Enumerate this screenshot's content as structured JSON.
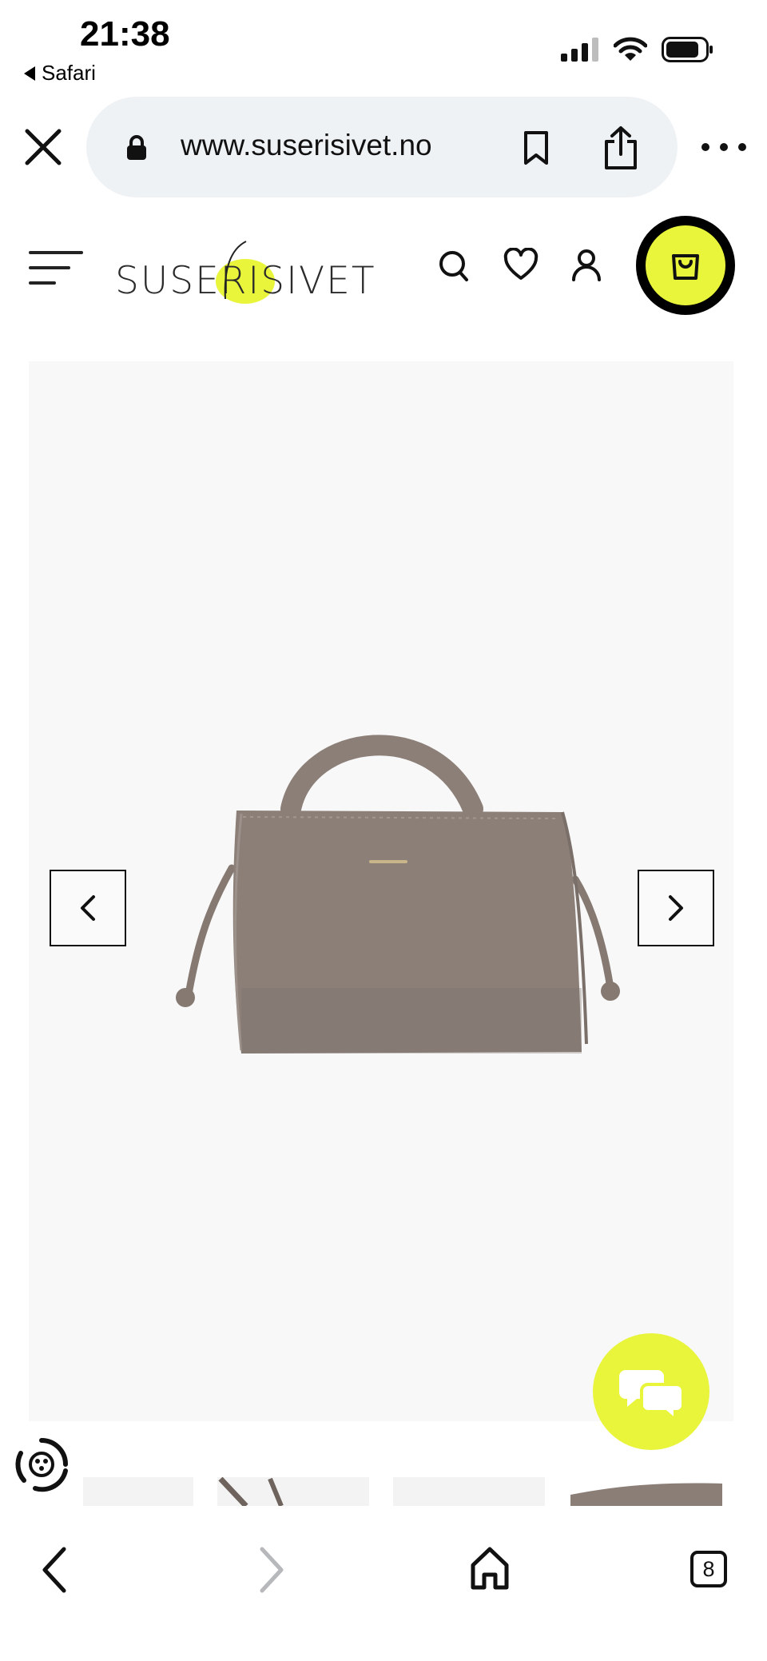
{
  "status_bar": {
    "time": "21:38",
    "back_app": "Safari",
    "icons": [
      "signal-icon",
      "wifi-icon",
      "battery-icon"
    ]
  },
  "browser": {
    "url": "www.suserisivet.no",
    "tabs_count": "8"
  },
  "site": {
    "logo_text": "SUSERISIVET",
    "accent_color": "#e8f53a"
  },
  "product": {
    "image_alt": "Taupe leather handbag",
    "gallery_index": null
  },
  "colors": {
    "accent": "#e8f53a",
    "text": "#111111",
    "url_bar_bg": "#eff2f5",
    "gallery_bg": "#f8f8f8",
    "bag": "#8b7f78"
  }
}
